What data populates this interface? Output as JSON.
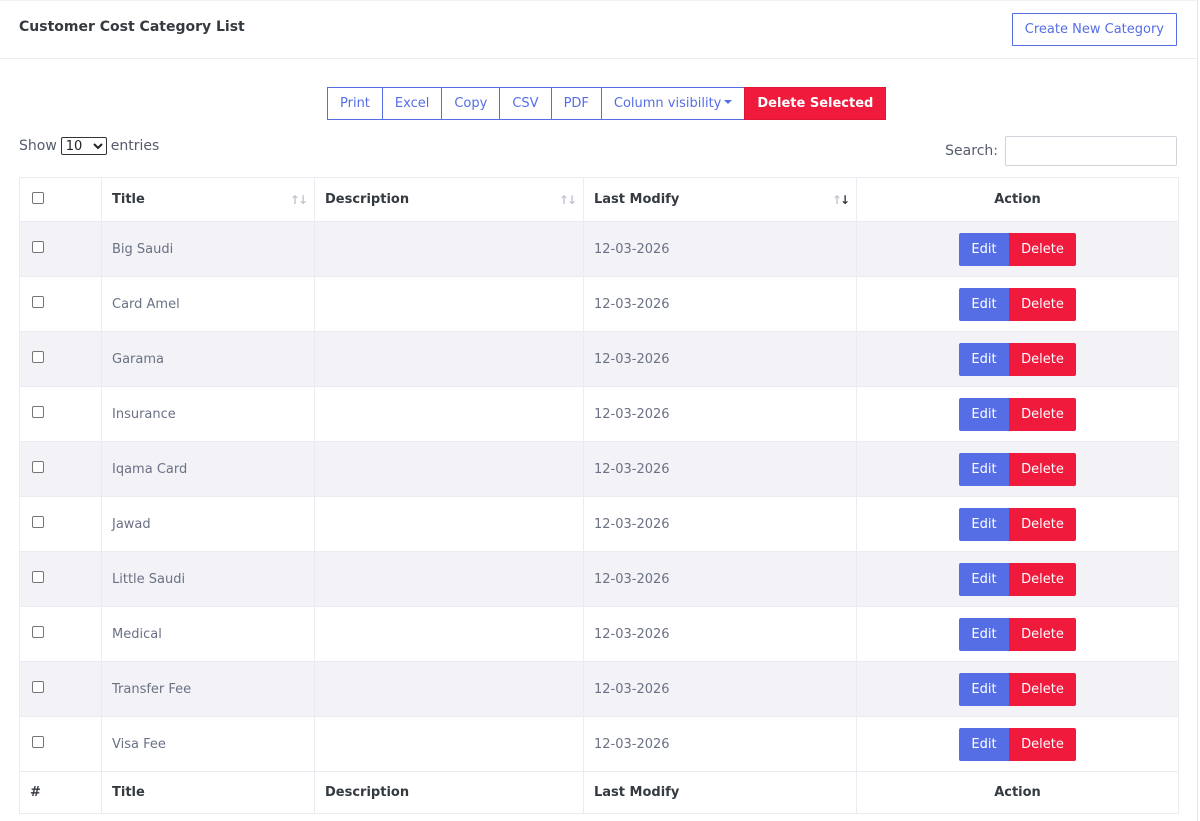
{
  "header": {
    "title": "Customer Cost Category List",
    "create_label": "Create New Category"
  },
  "toolbar": {
    "print": "Print",
    "excel": "Excel",
    "copy": "Copy",
    "csv": "CSV",
    "pdf": "PDF",
    "column_visibility": "Column visibility",
    "delete_selected": "Delete Selected"
  },
  "length": {
    "show": "Show",
    "selected": "10",
    "entries": "entries"
  },
  "search": {
    "label": "Search:",
    "value": "",
    "placeholder": ""
  },
  "table": {
    "columns": {
      "title": "Title",
      "description": "Description",
      "last_modify": "Last Modify",
      "action": "Action"
    },
    "footer": {
      "index": "#",
      "title": "Title",
      "description": "Description",
      "last_modify": "Last Modify",
      "action": "Action"
    },
    "edit_label": "Edit",
    "delete_label": "Delete",
    "rows": [
      {
        "title": "Big Saudi",
        "description": "",
        "last_modify": "12-03-2026"
      },
      {
        "title": "Card Amel",
        "description": "",
        "last_modify": "12-03-2026"
      },
      {
        "title": "Garama",
        "description": "",
        "last_modify": "12-03-2026"
      },
      {
        "title": "Insurance",
        "description": "",
        "last_modify": "12-03-2026"
      },
      {
        "title": "Iqama Card",
        "description": "",
        "last_modify": "12-03-2026"
      },
      {
        "title": "Jawad",
        "description": "",
        "last_modify": "12-03-2026"
      },
      {
        "title": "Little Saudi",
        "description": "",
        "last_modify": "12-03-2026"
      },
      {
        "title": "Medical",
        "description": "",
        "last_modify": "12-03-2026"
      },
      {
        "title": "Transfer Fee",
        "description": "",
        "last_modify": "12-03-2026"
      },
      {
        "title": "Visa Fee",
        "description": "",
        "last_modify": "12-03-2026"
      }
    ]
  },
  "colors": {
    "primary": "#556ee6",
    "danger": "#f01a3c",
    "stripe": "#f2f2f7"
  },
  "icons": {
    "sort": "sort-arrows-icon",
    "caret": "caret-down-icon",
    "checkbox": "checkbox-icon"
  }
}
